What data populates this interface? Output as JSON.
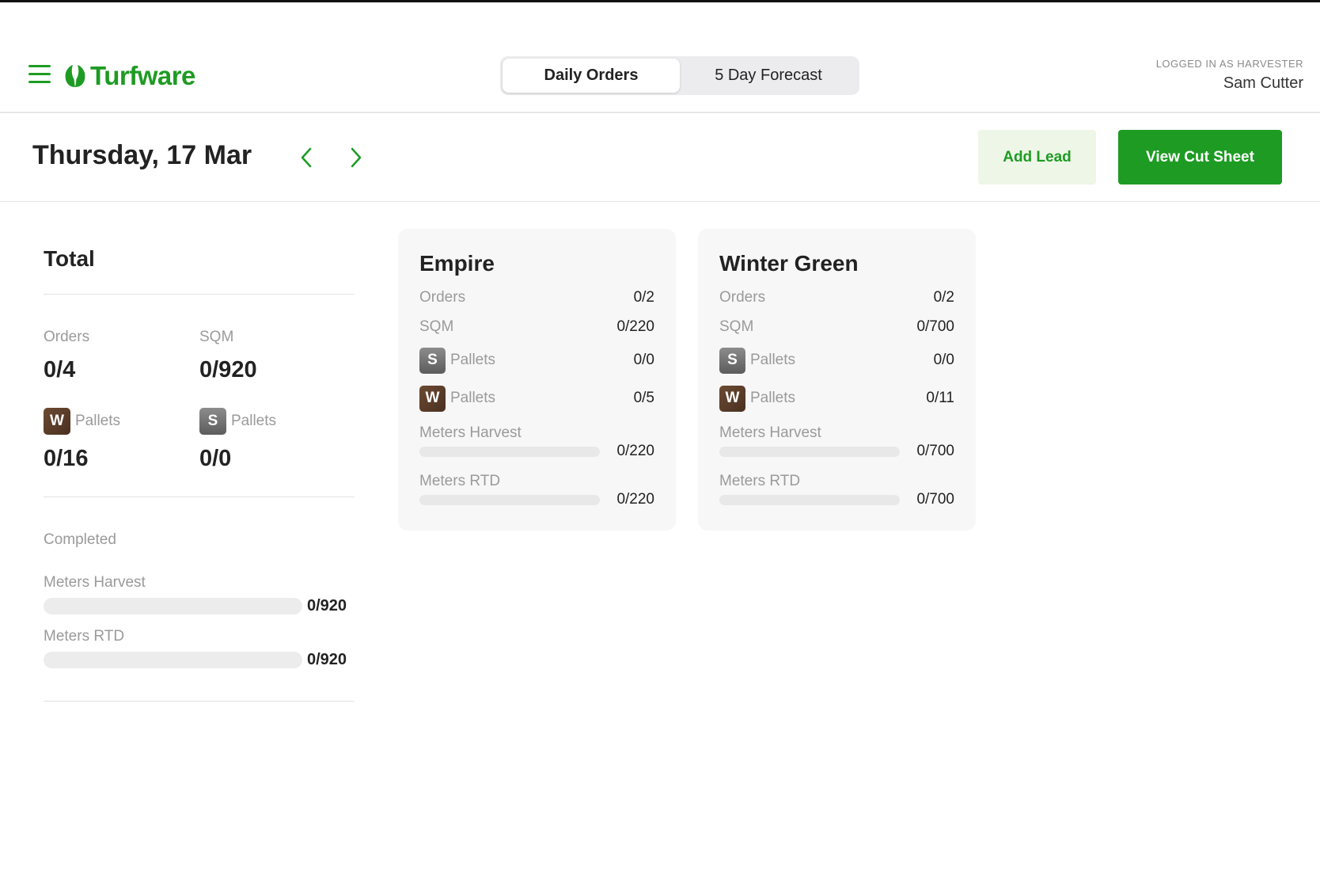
{
  "app": {
    "name": "Turfware",
    "brand_color": "#1e9b23",
    "menu_icon": "hamburger-menu-icon",
    "logo_icon": "leaf-logo-icon"
  },
  "tabs": [
    {
      "label": "Daily Orders",
      "active": true
    },
    {
      "label": "5 Day Forecast",
      "active": false
    }
  ],
  "user": {
    "role_label": "LOGGED IN AS HARVESTER",
    "name": "Sam Cutter"
  },
  "datebar": {
    "date": "Thursday, 17 Mar",
    "prev_icon": "chevron-left-icon",
    "next_icon": "chevron-right-icon",
    "add_lead_label": "Add Lead",
    "view_cut_sheet_label": "View Cut Sheet"
  },
  "total": {
    "title": "Total",
    "orders_label": "Orders",
    "orders_value": "0/4",
    "sqm_label": "SQM",
    "sqm_value": "0/920",
    "w_badge": "W",
    "w_pallets_label": "Pallets",
    "w_pallets_value": "0/16",
    "s_badge": "S",
    "s_pallets_label": "Pallets",
    "s_pallets_value": "0/0",
    "completed_label": "Completed",
    "meters_harvest_label": "Meters Harvest",
    "meters_harvest_value": "0/920",
    "meters_harvest_progress": 0,
    "meters_rtd_label": "Meters RTD",
    "meters_rtd_value": "0/920",
    "meters_rtd_progress": 0
  },
  "cards": [
    {
      "title": "Empire",
      "orders_label": "Orders",
      "orders_value": "0/2",
      "sqm_label": "SQM",
      "sqm_value": "0/220",
      "s_badge": "S",
      "s_pallets_label": "Pallets",
      "s_pallets_value": "0/0",
      "w_badge": "W",
      "w_pallets_label": "Pallets",
      "w_pallets_value": "0/5",
      "meters_harvest_label": "Meters Harvest",
      "meters_harvest_value": "0/220",
      "meters_harvest_progress": 0,
      "meters_rtd_label": "Meters RTD",
      "meters_rtd_value": "0/220",
      "meters_rtd_progress": 0
    },
    {
      "title": "Winter Green",
      "orders_label": "Orders",
      "orders_value": "0/2",
      "sqm_label": "SQM",
      "sqm_value": "0/700",
      "s_badge": "S",
      "s_pallets_label": "Pallets",
      "s_pallets_value": "0/0",
      "w_badge": "W",
      "w_pallets_label": "Pallets",
      "w_pallets_value": "0/11",
      "meters_harvest_label": "Meters Harvest",
      "meters_harvest_value": "0/700",
      "meters_harvest_progress": 0,
      "meters_rtd_label": "Meters RTD",
      "meters_rtd_value": "0/700",
      "meters_rtd_progress": 0
    }
  ]
}
